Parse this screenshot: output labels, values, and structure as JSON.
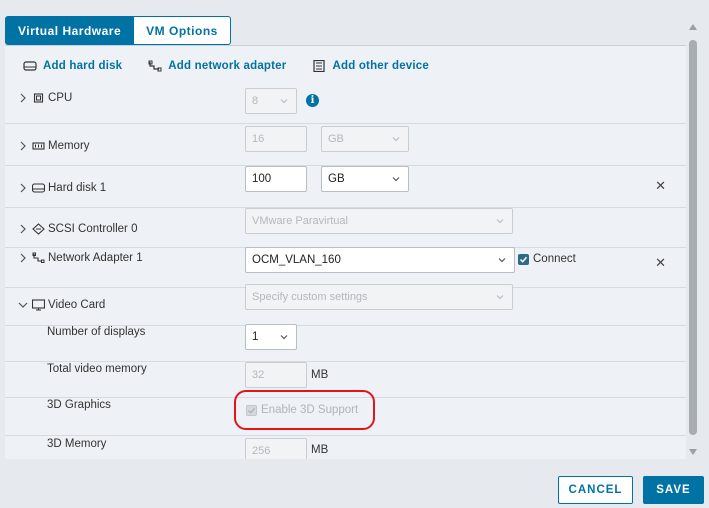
{
  "tabs": [
    {
      "label": "Virtual Hardware",
      "active": true
    },
    {
      "label": "VM Options",
      "active": false
    }
  ],
  "toolbar": {
    "add_hard_disk": "Add hard disk",
    "add_network_adapter": "Add network adapter",
    "add_other_device": "Add other device"
  },
  "cpu": {
    "label": "CPU",
    "value": "8"
  },
  "memory": {
    "label": "Memory",
    "value": "16",
    "unit": "GB"
  },
  "hard_disk": {
    "label": "Hard disk 1",
    "value": "100",
    "unit": "GB"
  },
  "scsi": {
    "label": "SCSI Controller 0",
    "value": "VMware Paravirtual"
  },
  "network": {
    "label": "Network Adapter 1",
    "value": "OCM_VLAN_160",
    "connect_label": "Connect"
  },
  "video_card": {
    "label": "Video Card",
    "value": "Specify custom settings",
    "num_displays_label": "Number of displays",
    "num_displays_value": "1",
    "total_memory_label": "Total video memory",
    "total_memory_value": "32",
    "total_memory_unit": "MB",
    "graphics_label": "3D Graphics",
    "enable_3d_label": "Enable 3D Support",
    "memory_3d_label": "3D Memory",
    "memory_3d_value": "256",
    "memory_3d_unit": "MB"
  },
  "buttons": {
    "cancel": "CANCEL",
    "save": "SAVE"
  },
  "colors": {
    "accent": "#0072a3",
    "highlight": "#e2141c"
  }
}
